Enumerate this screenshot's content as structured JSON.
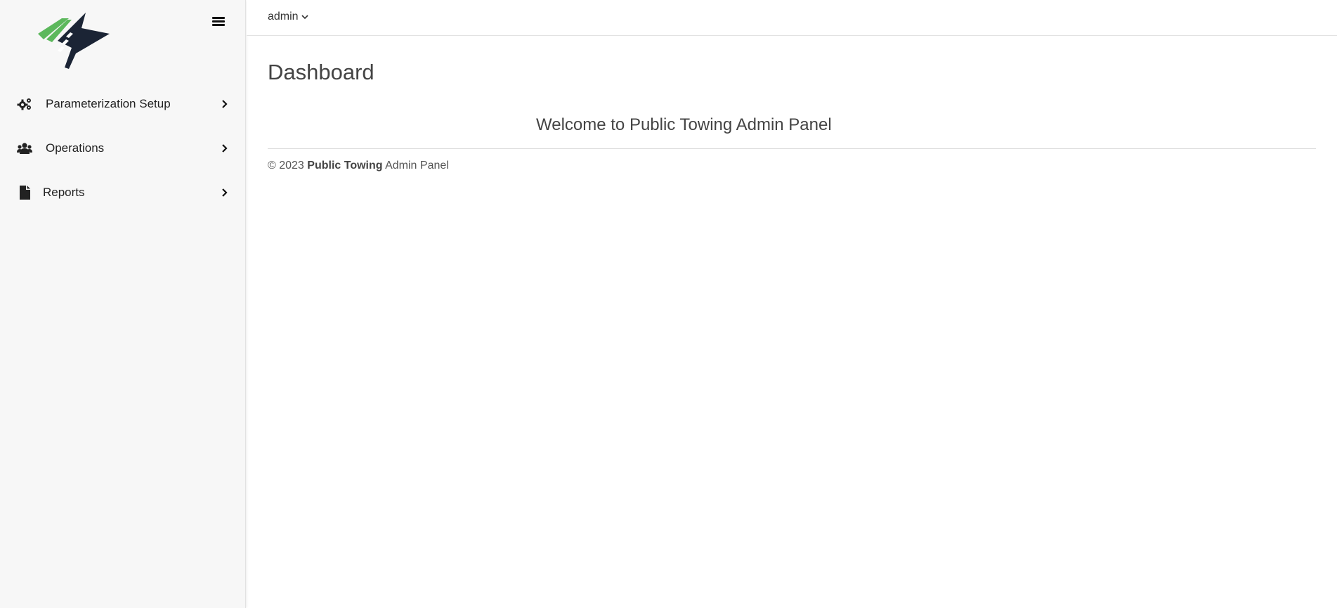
{
  "sidebar": {
    "logo_icon": "towing-road-logo",
    "menu_toggle_icon": "hamburger-icon",
    "items": [
      {
        "label": "Parameterization Setup",
        "icon": "cogs-icon"
      },
      {
        "label": "Operations",
        "icon": "users-icon"
      },
      {
        "label": "Reports",
        "icon": "file-icon"
      }
    ]
  },
  "topbar": {
    "user": "admin"
  },
  "main": {
    "title": "Dashboard",
    "welcome": "Welcome to Public Towing Admin Panel"
  },
  "footer": {
    "copyright": "© 2023",
    "brand": "Public Towing",
    "suffix": "Admin Panel"
  },
  "colors": {
    "logo_green": "#5cb85c",
    "logo_navy": "#1b2435",
    "sidebar_bg": "#f7f7f7"
  }
}
